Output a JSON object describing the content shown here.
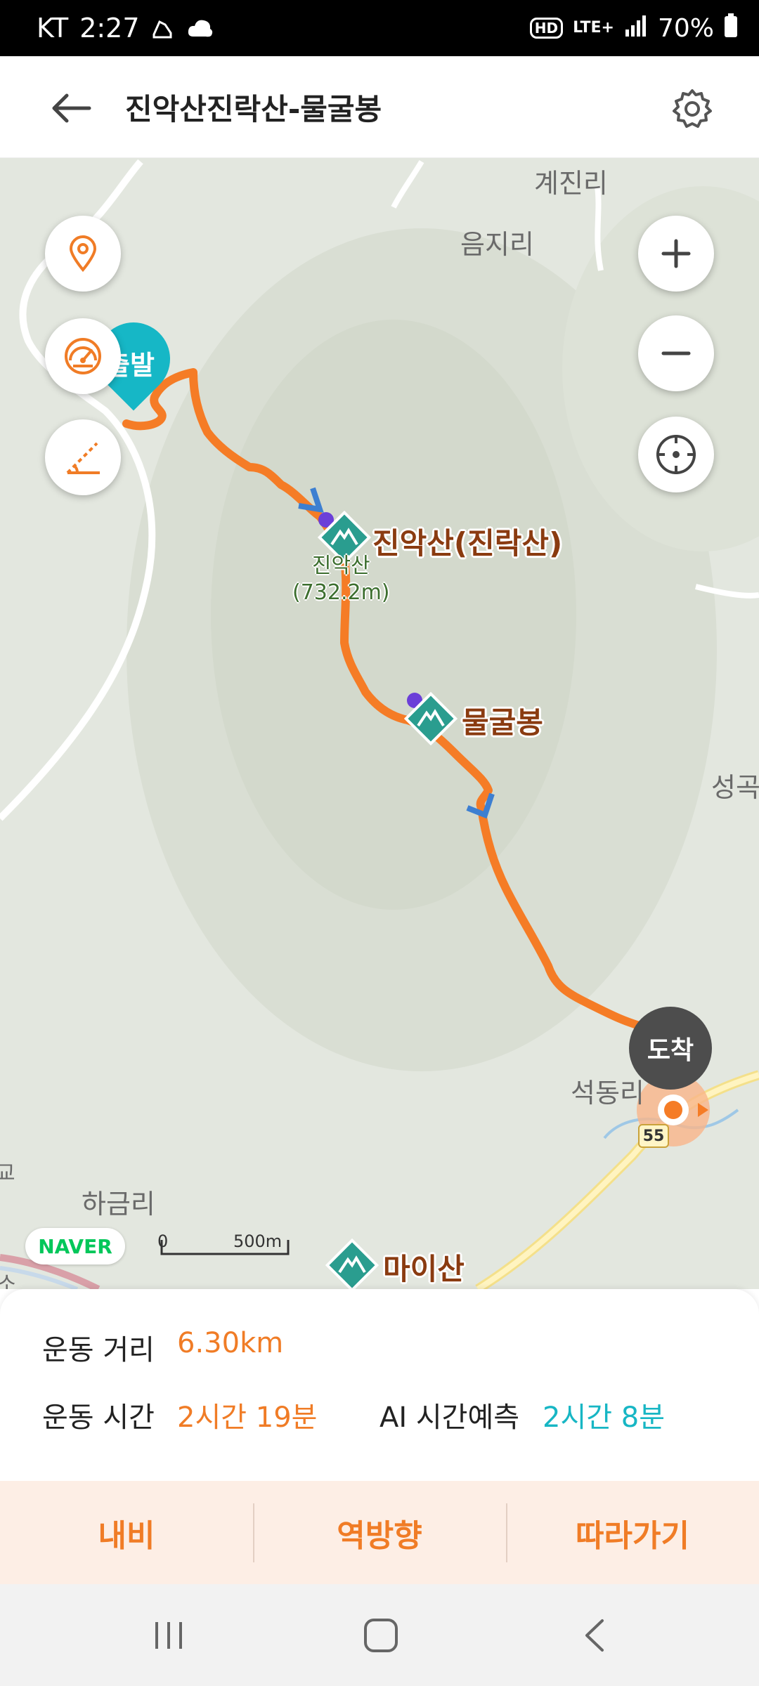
{
  "status_bar": {
    "carrier": "KT",
    "time": "2:27",
    "hd": "HD",
    "network": "LTE+",
    "battery": "70%"
  },
  "header": {
    "title": "진악산진락산-물굴봉"
  },
  "map": {
    "places": [
      "계진리",
      "음지리",
      "석동리",
      "하금리",
      "성곡",
      "교",
      "소"
    ],
    "peaks": [
      {
        "name": "진악산(진락산)",
        "sub": "진악산\n(732.2m)"
      },
      {
        "name": "물굴봉"
      },
      {
        "name": "마이산"
      }
    ],
    "start_label": "출발",
    "arrive_label": "도착",
    "road_number": "55",
    "brand": "NAVER",
    "scale": {
      "zero": "0",
      "distance": "500m"
    }
  },
  "stats": {
    "distance_label": "운동 거리",
    "distance_value": "6.30km",
    "time_label": "운동 시간",
    "time_value": "2시간 19분",
    "ai_label": "AI 시간예측",
    "ai_value": "2시간 8분"
  },
  "actions": [
    "내비",
    "역방향",
    "따라가기"
  ],
  "colors": {
    "accent": "#f07c26",
    "teal": "#17b6c4",
    "peak_icon": "#2a9d8f"
  }
}
